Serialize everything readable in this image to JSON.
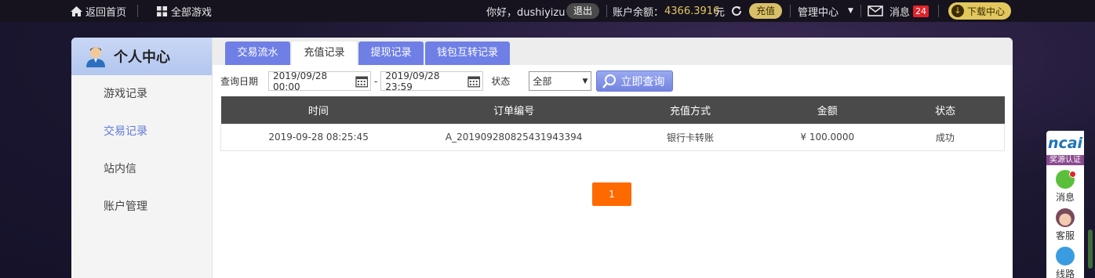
{
  "topbar": {
    "home_label": "返回首页",
    "all_games_label": "全部游戏",
    "greeting": "你好，dushiyizu",
    "logout_label": "退出",
    "balance_label": "账户余额：",
    "balance_value": "4366.3916",
    "balance_unit": "元",
    "recharge_label": "充值",
    "manage_label": "管理中心",
    "message_label": "消息",
    "message_count": "24",
    "download_label": "下载中心"
  },
  "sidebar": {
    "title": "个人中心",
    "items": [
      {
        "label": "游戏记录"
      },
      {
        "label": "交易记录"
      },
      {
        "label": "站内信"
      },
      {
        "label": "账户管理"
      }
    ]
  },
  "tabs": [
    {
      "label": "交易流水"
    },
    {
      "label": "充值记录"
    },
    {
      "label": "提现记录"
    },
    {
      "label": "钱包互转记录"
    }
  ],
  "filter": {
    "date_label": "查询日期",
    "start_date": "2019/09/28 00:00",
    "dash": "-",
    "end_date": "2019/09/28 23:59",
    "status_label": "状态",
    "status_value": "全部",
    "query_label": "立即查询"
  },
  "table": {
    "headers": [
      "时间",
      "订单编号",
      "充值方式",
      "金额",
      "状态"
    ],
    "rows": [
      [
        "2019-09-28 08:25:45",
        "A_20190928082543194339​4",
        "银行卡转账",
        "¥ 100.0000",
        "成功"
      ]
    ]
  },
  "pagination": {
    "current_page": "1"
  },
  "floatbar": {
    "logo_text": "ncai",
    "cert_label": "奖源认证",
    "message_label": "消息",
    "service_label": "客服",
    "route_label": "线路"
  },
  "colors": {
    "accent": "#6f7fe6",
    "pager": "#ff6a00",
    "gold": "#e2c75f"
  }
}
